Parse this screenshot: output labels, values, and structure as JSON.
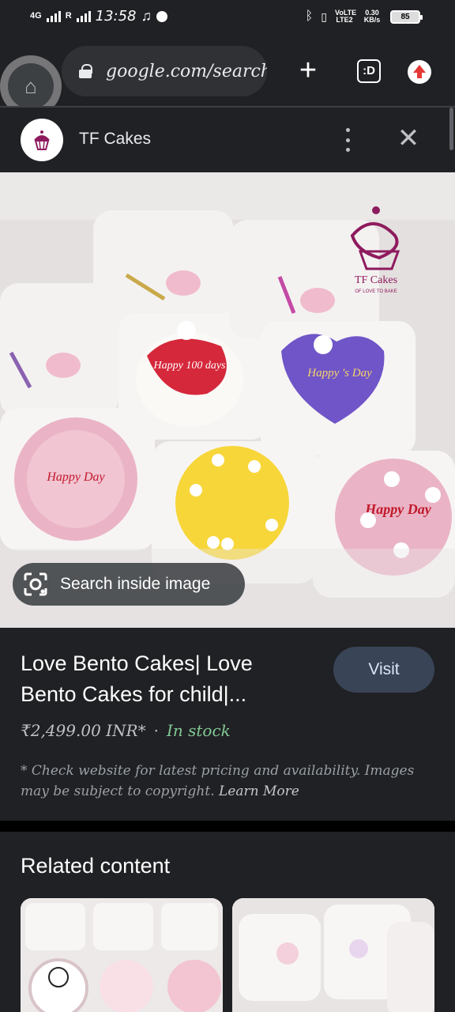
{
  "status_bar": {
    "network": "4G",
    "network_sub": "R",
    "time": "13:58",
    "carrier": "VoLTE LTE2",
    "speed_value": "0.30",
    "speed_unit": "KB/s",
    "battery": "85"
  },
  "browser": {
    "url": "google.com/search",
    "tabs_label": ":D"
  },
  "source": {
    "name": "TF Cakes"
  },
  "image": {
    "logo_text": "TF Cakes",
    "logo_tagline": "OF LOVE TO BAKE",
    "cake_texts": [
      "Happy 100 days",
      "Happy 's Day",
      "Happy Day",
      "Happy Day"
    ],
    "search_inside_label": "Search inside image"
  },
  "product": {
    "title": "Love Bento Cakes| Love Bento Cakes for child|...",
    "visit_label": "Visit",
    "price": "₹2,499.00 INR*",
    "separator": "·",
    "stock": "In stock",
    "disclaimer": "* Check website for latest pricing and availability. Images may be subject to copyright.",
    "learn_more": "Learn More"
  },
  "related": {
    "title": "Related content"
  },
  "colors": {
    "background": "#202124",
    "stock_green": "#81c995",
    "visit_button": "#394457",
    "update_red": "#e53935"
  }
}
